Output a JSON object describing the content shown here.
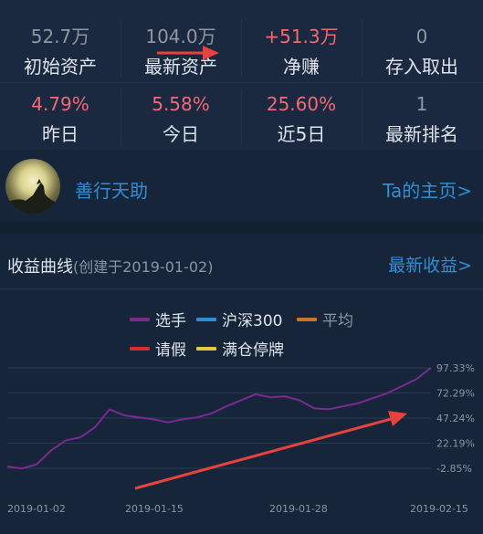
{
  "stats": {
    "row1": [
      {
        "value": "52.7万",
        "label": "初始资产",
        "color": "gray"
      },
      {
        "value": "104.0万",
        "label": "最新资产",
        "color": "gray"
      },
      {
        "value": "+51.3万",
        "label": "净赚",
        "color": "red"
      },
      {
        "value": "0",
        "label": "存入取出",
        "color": "gray"
      }
    ],
    "row2": [
      {
        "value": "4.79%",
        "label": "昨日",
        "color": "red"
      },
      {
        "value": "5.58%",
        "label": "今日",
        "color": "red"
      },
      {
        "value": "25.60%",
        "label": "近5日",
        "color": "red"
      },
      {
        "value": "1",
        "label": "最新排名",
        "color": "gray"
      }
    ]
  },
  "profile": {
    "name": "善行天助",
    "homepage_link": "Ta的主页>"
  },
  "curve": {
    "title": "收益曲线",
    "created": "(创建于2019-01-02)",
    "latest_link": "最新收益>"
  },
  "legend": [
    {
      "name": "选手",
      "color": "#7b2a8f"
    },
    {
      "name": "沪深300",
      "color": "#2f8fd3"
    },
    {
      "name": "平均",
      "color": "#c9762c"
    },
    {
      "name": "请假",
      "color": "#d62d2d"
    },
    {
      "name": "满仓停牌",
      "color": "#e7c73a"
    }
  ],
  "colors": {
    "accent_blue": "#2f8fd3",
    "value_red": "#f16a74",
    "annotation_arrow": "#e8423e"
  },
  "chart_data": {
    "type": "line",
    "x_ticks": [
      "2019-01-02",
      "2019-01-15",
      "2019-01-28",
      "2019-02-15"
    ],
    "y_ticks": [
      "97.33%",
      "72.29%",
      "47.24%",
      "22.19%",
      "-2.85%"
    ],
    "ylim": [
      -2.85,
      97.33
    ],
    "series": [
      {
        "name": "选手",
        "color": "#7b2a8f",
        "values": [
          -1,
          -3,
          1,
          15,
          25,
          28,
          38,
          56,
          50,
          48,
          46,
          43,
          46,
          48,
          52,
          59,
          65,
          71,
          68,
          69,
          65,
          57,
          56,
          59,
          62,
          67,
          72,
          79,
          86,
          97.33
        ]
      }
    ],
    "grid": true
  }
}
